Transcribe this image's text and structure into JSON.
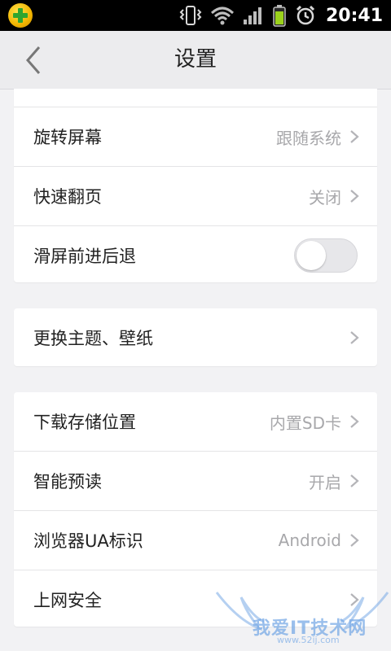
{
  "status_bar": {
    "time": "20:41",
    "icons": [
      "360-security-icon",
      "vibrate-icon",
      "wifi-icon",
      "signal-icon",
      "battery-icon",
      "alarm-icon"
    ]
  },
  "header": {
    "title": "设置",
    "back_icon": "chevron-left-icon"
  },
  "groups": [
    {
      "rows": [
        {
          "label": "旋转屏幕",
          "value": "跟随系统",
          "control": "chevron"
        },
        {
          "label": "快速翻页",
          "value": "关闭",
          "control": "chevron"
        },
        {
          "label": "滑屏前进后退",
          "value": "",
          "control": "toggle",
          "toggle_on": false
        }
      ]
    },
    {
      "rows": [
        {
          "label": "更换主题、壁纸",
          "value": "",
          "control": "chevron"
        }
      ]
    },
    {
      "rows": [
        {
          "label": "下载存储位置",
          "value": "内置SD卡",
          "control": "chevron"
        },
        {
          "label": "智能预读",
          "value": "开启",
          "control": "chevron"
        },
        {
          "label": "浏览器UA标识",
          "value": "Android",
          "control": "chevron"
        },
        {
          "label": "上网安全",
          "value": "",
          "control": "chevron"
        }
      ]
    }
  ],
  "watermark": {
    "text": "我爱IT技术网",
    "sub": "www.52ij.com"
  },
  "colors": {
    "background": "#f2f2f4",
    "card": "#ffffff",
    "value_text": "#a8a8ab",
    "label_text": "#222222"
  }
}
